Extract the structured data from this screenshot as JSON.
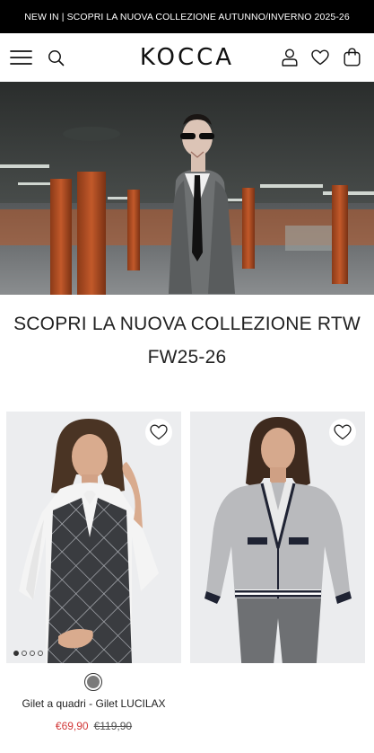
{
  "promo": {
    "text": "NEW IN | SCOPRI LA NUOVA COLLEZIONE AUTUNNO/INVERNO 2025-26"
  },
  "header": {
    "logo": "KOCCA",
    "icons": [
      "menu-icon",
      "search-icon",
      "account-icon",
      "heart-icon",
      "shopping-bag-icon"
    ]
  },
  "hero": {
    "image": "campaign-photo"
  },
  "section": {
    "title_line1": "SCOPRI LA NUOVA COLLEZIONE RTW",
    "title_line2": "FW25-26"
  },
  "products": [
    {
      "name": "Gilet a quadri - Gilet LUCILAX",
      "price": "€69,90",
      "old_price": "€119,90",
      "swatch_color": "#7a7a7a",
      "carousel_dots": 4,
      "active_dot": 1
    },
    {
      "name": "",
      "price": "",
      "old_price": ""
    }
  ]
}
